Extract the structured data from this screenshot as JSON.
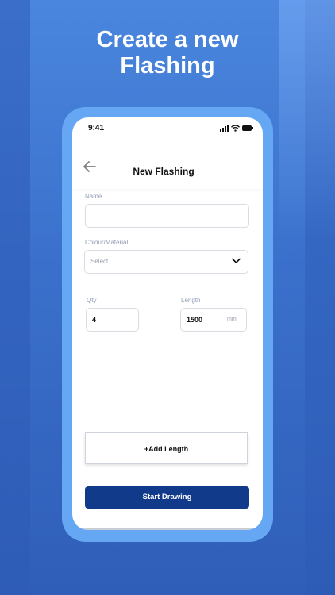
{
  "headline": {
    "line1": "Create a new",
    "line2": "Flashing"
  },
  "status_bar": {
    "time": "9:41",
    "icons": [
      "signal-icon",
      "wifi-icon",
      "battery-icon"
    ]
  },
  "nav": {
    "back_icon": "arrow-left-icon",
    "title": "New Flashing"
  },
  "form": {
    "name": {
      "label": "Name",
      "value": ""
    },
    "colour_material": {
      "label": "Colour/Material",
      "selected": "Select",
      "icon": "chevron-down-icon"
    },
    "qty": {
      "label": "Qty",
      "value": "4"
    },
    "length": {
      "label": "Length",
      "value": "1500",
      "unit": "mm"
    }
  },
  "buttons": {
    "add_length": "+Add Length",
    "start_drawing": "Start Drawing"
  },
  "colors": {
    "primary": "#123a8a",
    "frame": "#66a7f3",
    "background": "#3a70cb"
  }
}
